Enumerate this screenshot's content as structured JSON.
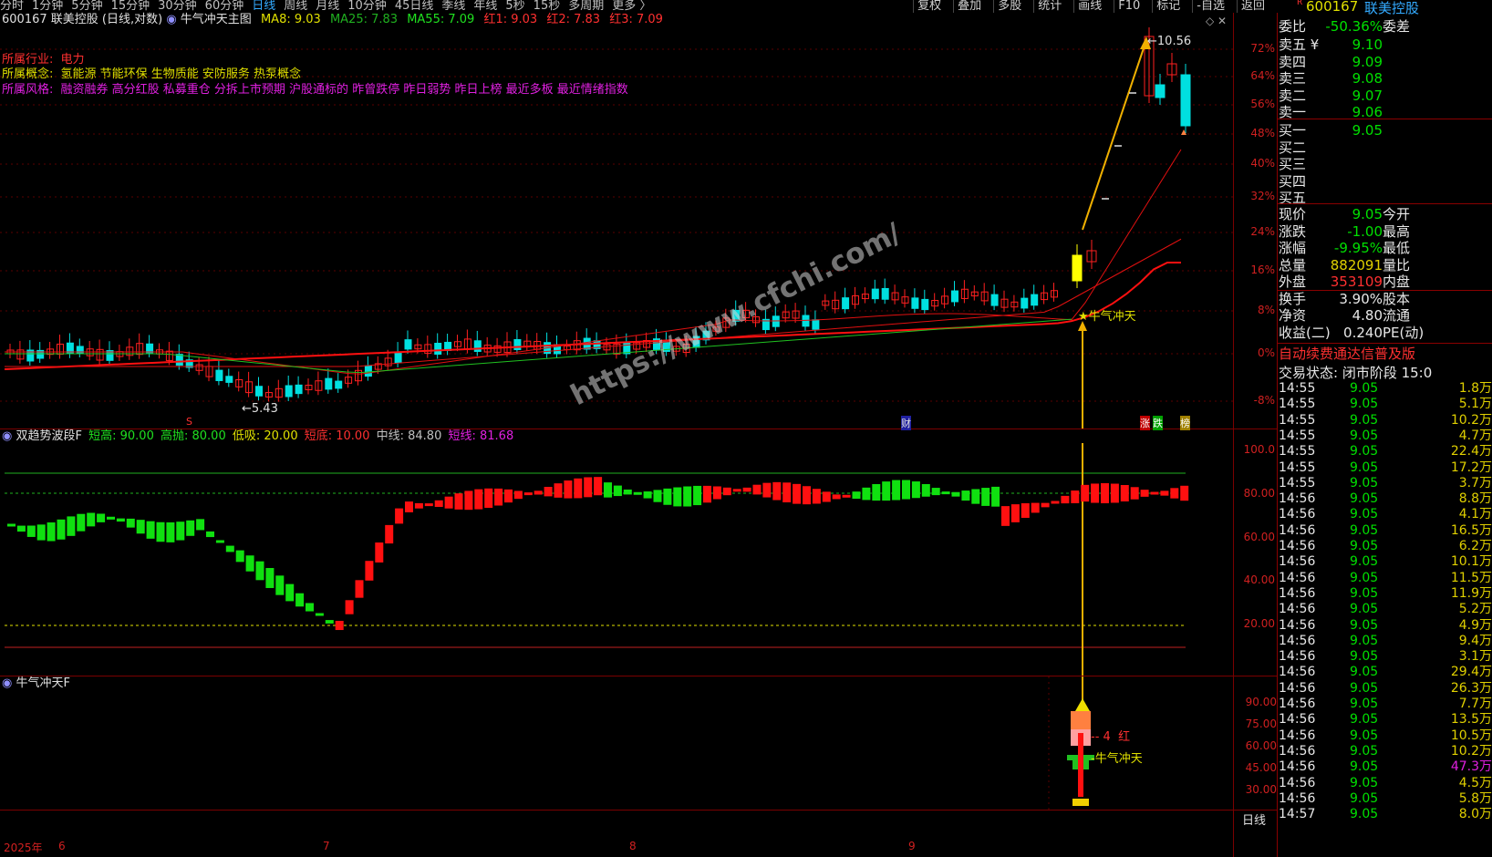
{
  "toolbar": {
    "periods": [
      "分时",
      "1分钟",
      "5分钟",
      "15分钟",
      "30分钟",
      "60分钟",
      "日线",
      "周线",
      "月线",
      "10分钟",
      "45日线",
      "季线",
      "年线",
      "5秒",
      "15秒",
      "多周期",
      "更多 〉"
    ],
    "active_period": "日线",
    "right_tools": [
      "复权",
      "叠加",
      "多股",
      "统计",
      "画线",
      "F10",
      "标记",
      "-自选",
      "返回"
    ]
  },
  "main_header": {
    "stock": "600167 联美控股 (日线,对数)",
    "indicator": "牛气冲天主图",
    "ma8": "MA8: 9.03",
    "ma25": "MA25: 7.83",
    "ma55": "MA55: 7.09",
    "hong1": "红1: 9.03",
    "hong2": "红2: 7.83",
    "hong3": "红3: 7.09"
  },
  "info": {
    "industry_label": "所属行业:",
    "industry": "电力",
    "concept_label": "所属概念:",
    "concept": "氢能源 节能环保 生物质能 安防服务 热泵概念",
    "style_label": "所属风格:",
    "style": "融资融券 高分红股 私募重仓 分拆上市预期 沪股通标的 昨曾跌停 昨日弱势 昨日上榜 最近多板 最近情绪指数"
  },
  "main_annotations": {
    "high": "10.56",
    "low": "5.43",
    "signal": "★牛气冲天",
    "markers": [
      "S",
      "财",
      "涨",
      "跌",
      "榜"
    ]
  },
  "main_axis": [
    "72%",
    "64%",
    "56%",
    "48%",
    "40%",
    "32%",
    "24%",
    "16%",
    "8%",
    "0%",
    "-8%"
  ],
  "osc_header": {
    "name": "双趋势波段F",
    "duangao": "短高: 90.00",
    "gaopao": "高抛: 80.00",
    "dixi": "低吸: 20.00",
    "duandi": "短底: 10.00",
    "zhongxian": "中线: 84.80",
    "duanxian": "短线: 81.68"
  },
  "osc_axis": [
    "100.0",
    "80.00",
    "60.00",
    "40.00",
    "20.00"
  ],
  "bull_header": {
    "name": "牛气冲天F"
  },
  "bull_axis": [
    "90.00",
    "75.00",
    "60.00",
    "45.00",
    "30.00"
  ],
  "bull_annotations": {
    "count": "4",
    "color_word": "红",
    "signal": "牛气冲天"
  },
  "x_axis": [
    "2025年",
    "6",
    "7",
    "8",
    "9"
  ],
  "x_axis_right": "日线",
  "watermark": "https://www.cfchi.com/",
  "quote": {
    "code": "600167",
    "name": "联美控股",
    "weibi_label": "委比",
    "weibi": "-50.36%",
    "weicha_label": "委差",
    "asks": [
      {
        "label": "卖五 ¥",
        "price": "9.10"
      },
      {
        "label": "卖四",
        "price": "9.09"
      },
      {
        "label": "卖三",
        "price": "9.08"
      },
      {
        "label": "卖二",
        "price": "9.07"
      },
      {
        "label": "卖一",
        "price": "9.06"
      }
    ],
    "bids": [
      {
        "label": "买一",
        "price": "9.05"
      },
      {
        "label": "买二",
        "price": ""
      },
      {
        "label": "买三",
        "price": ""
      },
      {
        "label": "买四",
        "price": ""
      },
      {
        "label": "买五",
        "price": ""
      }
    ],
    "stats": [
      {
        "k": "现价",
        "v": "9.05",
        "k2": "今开",
        "color": "#00e000"
      },
      {
        "k": "涨跌",
        "v": "-1.00",
        "k2": "最高",
        "color": "#00e000"
      },
      {
        "k": "涨幅",
        "v": "-9.95%",
        "k2": "最低",
        "color": "#00e000"
      },
      {
        "k": "总量",
        "v": "882091",
        "k2": "量比",
        "color": "#e0d000"
      },
      {
        "k": "外盘",
        "v": "353109",
        "k2": "内盘",
        "color": "#ff3030"
      },
      {
        "k": "换手",
        "v": "3.90%",
        "k2": "股本",
        "color": "#e8e8e8"
      },
      {
        "k": "净资",
        "v": "4.80",
        "k2": "流通",
        "color": "#e8e8e8"
      },
      {
        "k": "收益(二)",
        "v": "0.240",
        "k2": "PE(动)",
        "color": "#e8e8e8"
      }
    ],
    "banner": "自动续费通达信普及版",
    "trade_status": "交易状态: 闭市阶段 15:0",
    "ticks": [
      {
        "t": "14:55",
        "p": "9.05",
        "q": "1.8万"
      },
      {
        "t": "14:55",
        "p": "9.05",
        "q": "5.1万"
      },
      {
        "t": "14:55",
        "p": "9.05",
        "q": "10.2万"
      },
      {
        "t": "14:55",
        "p": "9.05",
        "q": "4.7万"
      },
      {
        "t": "14:55",
        "p": "9.05",
        "q": "22.4万"
      },
      {
        "t": "14:55",
        "p": "9.05",
        "q": "17.2万"
      },
      {
        "t": "14:55",
        "p": "9.05",
        "q": "3.7万"
      },
      {
        "t": "14:56",
        "p": "9.05",
        "q": "8.8万"
      },
      {
        "t": "14:56",
        "p": "9.05",
        "q": "4.1万"
      },
      {
        "t": "14:56",
        "p": "9.05",
        "q": "16.5万"
      },
      {
        "t": "14:56",
        "p": "9.05",
        "q": "6.2万"
      },
      {
        "t": "14:56",
        "p": "9.05",
        "q": "10.1万"
      },
      {
        "t": "14:56",
        "p": "9.05",
        "q": "11.5万"
      },
      {
        "t": "14:56",
        "p": "9.05",
        "q": "11.9万"
      },
      {
        "t": "14:56",
        "p": "9.05",
        "q": "5.2万"
      },
      {
        "t": "14:56",
        "p": "9.05",
        "q": "4.9万"
      },
      {
        "t": "14:56",
        "p": "9.05",
        "q": "9.4万"
      },
      {
        "t": "14:56",
        "p": "9.05",
        "q": "3.1万"
      },
      {
        "t": "14:56",
        "p": "9.05",
        "q": "29.4万"
      },
      {
        "t": "14:56",
        "p": "9.05",
        "q": "26.3万"
      },
      {
        "t": "14:56",
        "p": "9.05",
        "q": "7.7万"
      },
      {
        "t": "14:56",
        "p": "9.05",
        "q": "13.5万"
      },
      {
        "t": "14:56",
        "p": "9.05",
        "q": "10.5万"
      },
      {
        "t": "14:56",
        "p": "9.05",
        "q": "10.2万"
      },
      {
        "t": "14:56",
        "p": "9.05",
        "q": "47.3万"
      },
      {
        "t": "14:56",
        "p": "9.05",
        "q": "4.5万"
      },
      {
        "t": "14:56",
        "p": "9.05",
        "q": "5.8万"
      },
      {
        "t": "14:57",
        "p": "9.05",
        "q": "8.0万"
      }
    ]
  },
  "colors": {
    "up": "#ff2020",
    "down": "#00e0e0",
    "osc_up": "#ff1010",
    "osc_down": "#10e010",
    "ma8": "#e0e0e0",
    "ma_green": "#20c020",
    "arrow": "#f0b000"
  }
}
